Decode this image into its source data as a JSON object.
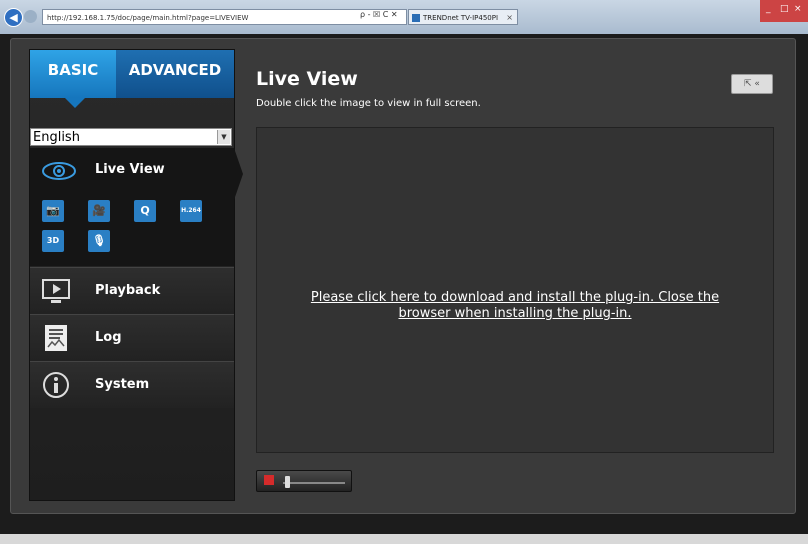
{
  "browser": {
    "address": "http://192.168.1.75/doc/page/main.html?page=LIVEVIEW",
    "address_controls": "ρ - ☒ C ✕",
    "tab_title": "TRENDnet TV-IP450PI",
    "tab_close": "×"
  },
  "sidebar": {
    "mode_basic": "BASIC",
    "mode_advanced": "ADVANCED",
    "language": "English",
    "live_view": {
      "label": "Live View",
      "tools": [
        "📷",
        "🎥",
        "Q",
        "H.264",
        "3D",
        "🎙"
      ]
    },
    "items": [
      {
        "label": "Playback"
      },
      {
        "label": "Log"
      },
      {
        "label": "System"
      }
    ]
  },
  "main": {
    "title": "Live View",
    "subtitle": "Double click the image to view in full screen.",
    "fullscreen_button": "⇱ «",
    "plugin_message": "Please click here to download and install the plug-in. Close the browser when installing the plug-in."
  },
  "colors": {
    "accent": "#1f7bc2",
    "background": "#3a3a3a",
    "viewer": "#333333"
  }
}
